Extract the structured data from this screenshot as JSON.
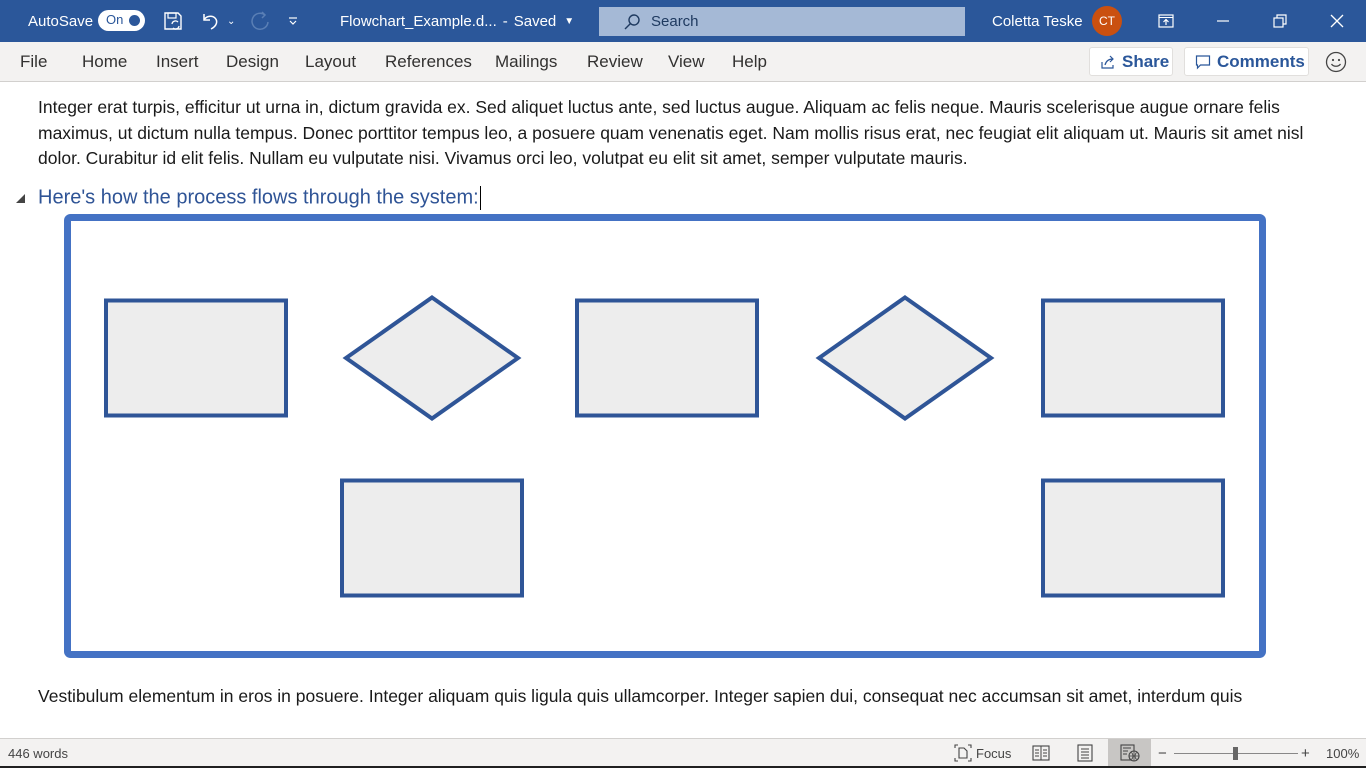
{
  "titlebar": {
    "autosave_label": "AutoSave",
    "autosave_state": "On",
    "filename": "Flowchart_Example.d...",
    "separator": "-",
    "save_status": "Saved",
    "search_placeholder": "Search",
    "user_name": "Coletta Teske",
    "user_initials": "CT",
    "icons": [
      "save-sync-icon",
      "undo-icon",
      "undo-dropdown-icon",
      "redo-icon",
      "customize-toolbar-icon",
      "search-icon",
      "ribbon-display-icon",
      "minimize-icon",
      "restore-icon",
      "close-icon"
    ],
    "colors": {
      "bar": "#2b579a",
      "avatar": "#ca5010",
      "search_bg": "#a5b9d6"
    }
  },
  "menubar": {
    "tabs": [
      {
        "label": "File"
      },
      {
        "label": "Home"
      },
      {
        "label": "Insert"
      },
      {
        "label": "Design"
      },
      {
        "label": "Layout"
      },
      {
        "label": "References"
      },
      {
        "label": "Mailings"
      },
      {
        "label": "Review"
      },
      {
        "label": "View"
      },
      {
        "label": "Help"
      }
    ],
    "share_label": "Share",
    "comments_label": "Comments",
    "feedback_icon": "smiley-icon"
  },
  "document": {
    "paragraph1": "Integer erat turpis, efficitur ut urna in, dictum gravida ex. Sed aliquet luctus ante, sed luctus augue. Aliquam ac felis neque. Mauris scelerisque augue ornare felis maximus, ut dictum nulla tempus. Donec porttitor tempus leo, a posuere quam venenatis eget. Nam mollis risus erat, nec feugiat elit aliquam ut. Mauris sit amet nisl dolor. Curabitur id elit felis. Nullam eu vulputate nisi. Vivamus orci leo, volutpat eu elit sit amet, semper vulputate mauris.",
    "heading": "Here's how the process flows through the system:",
    "paragraph2": "Vestibulum elementum in eros in posuere. Integer aliquam quis ligula quis ullamcorper. Integer sapien dui, consequat nec accumsan sit amet, interdum quis",
    "flowchart": {
      "frame_color": "#4472c4",
      "shape_stroke": "#2f5597",
      "shape_fill": "#ededed",
      "shapes": [
        {
          "type": "process",
          "row": 1,
          "col": 1
        },
        {
          "type": "decision",
          "row": 1,
          "col": 2
        },
        {
          "type": "process",
          "row": 1,
          "col": 3
        },
        {
          "type": "decision",
          "row": 1,
          "col": 4
        },
        {
          "type": "process",
          "row": 1,
          "col": 5
        },
        {
          "type": "process",
          "row": 2,
          "col": 2
        },
        {
          "type": "process",
          "row": 2,
          "col": 5
        }
      ]
    }
  },
  "statusbar": {
    "word_count": "446 words",
    "focus_label": "Focus",
    "zoom_minus": "−",
    "zoom_plus": "+",
    "zoom_level": "100%",
    "zoom_percent": 100,
    "active_view": "web-layout"
  }
}
